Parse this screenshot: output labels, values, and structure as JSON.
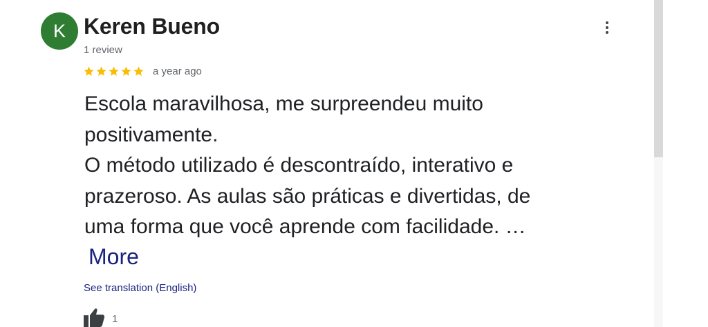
{
  "reviewer": {
    "avatar_letter": "K",
    "avatar_color": "#2e7d32",
    "name": "Keren Bueno",
    "review_count": "1 review"
  },
  "review": {
    "rating": 5,
    "rating_max": 5,
    "star_color": "#fbbc04",
    "time": "a year ago",
    "text_lines": [
      "Escola maravilhosa, me surpreendeu muito",
      "positivamente.",
      "O método utilizado é descontraído, interativo e",
      "prazeroso. As aulas são práticas e divertidas, de",
      "uma forma que você aprende com facilidade. …"
    ],
    "more_label": "More",
    "translate_label": "See translation (English)",
    "like_count": "1"
  },
  "icons": {
    "menu": "more-vert-icon",
    "star": "star-icon",
    "like": "thumbs-up-icon"
  },
  "colors": {
    "link": "#1a237e",
    "secondary_text": "#5f6368"
  }
}
